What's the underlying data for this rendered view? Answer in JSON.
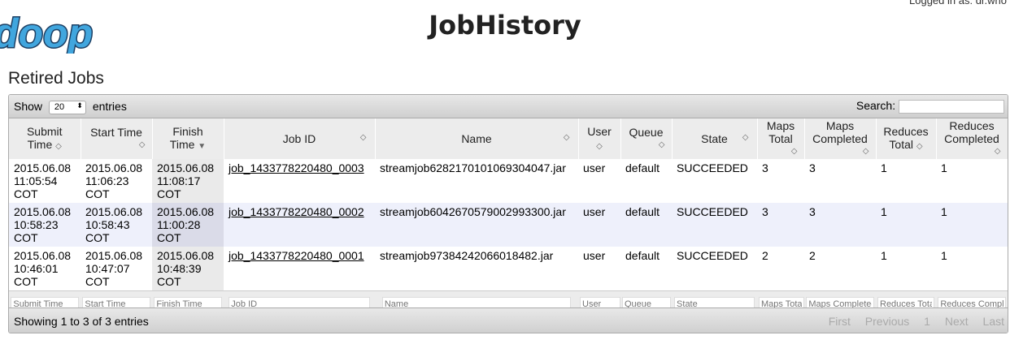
{
  "header": {
    "logo_text": "doop",
    "login_text": "Logged in as: dr.who",
    "page_title": "JobHistory"
  },
  "section_title": "Retired Jobs",
  "toolbar": {
    "show_label": "Show",
    "page_length": "20",
    "entries_label": "entries",
    "search_label": "Search:",
    "search_value": ""
  },
  "table": {
    "columns": [
      {
        "line1": "Submit",
        "line2": "Time"
      },
      {
        "line1": "Start Time",
        "line2": ""
      },
      {
        "line1": "Finish",
        "line2": "Time"
      },
      {
        "line1": "Job ID",
        "line2": ""
      },
      {
        "line1": "Name",
        "line2": ""
      },
      {
        "line1": "User",
        "line2": ""
      },
      {
        "line1": "Queue",
        "line2": ""
      },
      {
        "line1": "State",
        "line2": ""
      },
      {
        "line1": "Maps",
        "line2": "Total"
      },
      {
        "line1": "Maps",
        "line2": "Completed"
      },
      {
        "line1": "Reduces",
        "line2": "Total"
      },
      {
        "line1": "Reduces",
        "line2": "Completed"
      }
    ],
    "rows": [
      {
        "submit": [
          "2015.06.08",
          "11:05:54",
          "COT"
        ],
        "start": [
          "2015.06.08",
          "11:06:23",
          "COT"
        ],
        "finish": [
          "2015.06.08",
          "11:08:17",
          "COT"
        ],
        "job_id": "job_1433778220480_0003",
        "name": "streamjob6282170101069304047.jar",
        "user": "user",
        "queue": "default",
        "state": "SUCCEEDED",
        "maps_total": "3",
        "maps_completed": "3",
        "reduces_total": "1",
        "reduces_completed": "1"
      },
      {
        "submit": [
          "2015.06.08",
          "10:58:23",
          "COT"
        ],
        "start": [
          "2015.06.08",
          "10:58:43",
          "COT"
        ],
        "finish": [
          "2015.06.08",
          "11:00:28",
          "COT"
        ],
        "job_id": "job_1433778220480_0002",
        "name": "streamjob6042670579002993300.jar",
        "user": "user",
        "queue": "default",
        "state": "SUCCEEDED",
        "maps_total": "3",
        "maps_completed": "3",
        "reduces_total": "1",
        "reduces_completed": "1"
      },
      {
        "submit": [
          "2015.06.08",
          "10:46:01",
          "COT"
        ],
        "start": [
          "2015.06.08",
          "10:47:07",
          "COT"
        ],
        "finish": [
          "2015.06.08",
          "10:48:39",
          "COT"
        ],
        "job_id": "job_1433778220480_0001",
        "name": "streamjob97384242066018482.jar",
        "user": "user",
        "queue": "default",
        "state": "SUCCEEDED",
        "maps_total": "2",
        "maps_completed": "2",
        "reduces_total": "1",
        "reduces_completed": "1"
      }
    ],
    "filters": [
      "Submit Time",
      "Start Time",
      "Finish Time",
      "Job ID",
      "Name",
      "User",
      "Queue",
      "State",
      "Maps Total",
      "Maps Completed",
      "Reduces Total",
      "Reduces Completed"
    ]
  },
  "footer": {
    "info": "Showing 1 to 3 of 3 entries",
    "pager": {
      "first": "First",
      "previous": "Previous",
      "page": "1",
      "next": "Next",
      "last": "Last"
    }
  },
  "icons": {
    "sort_both": "sort-both-icon",
    "sort_desc": "sort-desc-icon",
    "select_arrows": "select-arrows-icon"
  },
  "colors": {
    "header_bg": "#ececec",
    "even_row_bg": "#eef0fb",
    "sorted_col_bg": "#eaeaea",
    "logo_blue": "#41a6de"
  }
}
